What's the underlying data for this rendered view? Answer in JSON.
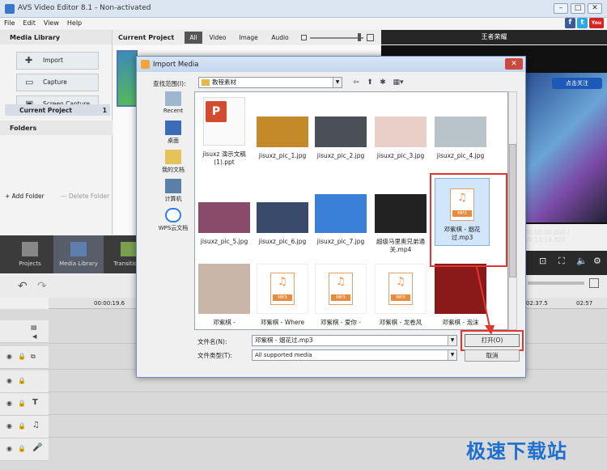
{
  "window": {
    "title": "AVS Video Editor 8.1 - Non-activated"
  },
  "menu": [
    "File",
    "Edit",
    "View",
    "Help"
  ],
  "social": [
    {
      "label": "f",
      "color": "#3b5998"
    },
    {
      "label": "t",
      "color": "#29a9e1"
    },
    {
      "label": "You",
      "color": "#d42424"
    }
  ],
  "left_panel": {
    "title": "Media Library",
    "buttons": [
      "Import",
      "Capture",
      "Screen Capture"
    ],
    "folders_title": "Folders",
    "folder": {
      "name": "Current Project",
      "count": "1"
    },
    "add_folder": "+ Add Folder",
    "delete_folder": "— Delete Folder"
  },
  "project": {
    "title": "Current Project",
    "tabs": [
      "All",
      "Video",
      "Image",
      "Audio"
    ]
  },
  "preview": {
    "title": "王者荣耀",
    "badge": "点击关注",
    "time": "00:00:00.000 / 00:13:19.400"
  },
  "toolstrip": [
    "Projects",
    "Media Library",
    "Transitions"
  ],
  "timeline": {
    "t1": "00:00:19.6",
    "t2": "02:37.5",
    "t3": "02:57"
  },
  "dialog": {
    "title": "Import Media",
    "look_in_label": "查找范围(I):",
    "look_in_value": "教程素材",
    "places": [
      "Recent",
      "桌面",
      "我的文档",
      "计算机",
      "WPS云文档"
    ],
    "files": [
      {
        "name": "jisuxz 演示文稿(1).ppt",
        "kind": "ppt"
      },
      {
        "name": "jisuxz_pic_1.jpg",
        "kind": "img",
        "color": "#c48a2a"
      },
      {
        "name": "jisuxz_pic_2.jpg",
        "kind": "img",
        "color": "#4b4f58"
      },
      {
        "name": "jisuxz_pic_3.jpg",
        "kind": "img",
        "color": "#e9cfc7"
      },
      {
        "name": "jisuxz_pic_4.jpg",
        "kind": "img",
        "color": "#b9c4c8"
      },
      {
        "name": "jisuxz_pic_5.jpg",
        "kind": "img",
        "color": "#8a4a6a"
      },
      {
        "name": "jisuxz_pic_6.jpg",
        "kind": "img",
        "color": "#3a4a6a"
      },
      {
        "name": "jisuxz_pic_7.jpg",
        "kind": "img",
        "color": "#3a7fd8"
      },
      {
        "name": "超级马里奥兄弟通关.mp4",
        "kind": "img",
        "color": "#222222"
      },
      {
        "name": "邓紫棋 - 烟花过.mp3",
        "kind": "mp3"
      },
      {
        "name": "邓紫棋 -",
        "kind": "img",
        "color": "#c9b6a8"
      },
      {
        "name": "邓紫棋 - Where",
        "kind": "mp3"
      },
      {
        "name": "邓紫棋 - 爱你 -",
        "kind": "mp3"
      },
      {
        "name": "邓紫棋 - 龙卷风",
        "kind": "mp3"
      },
      {
        "name": "邓紫棋 - 泡沫",
        "kind": "img",
        "color": "#8a1a1a"
      }
    ],
    "filename_label": "文件名(N):",
    "filename_value": "邓紫棋 - 烟花过.mp3",
    "filetype_label": "文件类型(T):",
    "filetype_value": "All supported media",
    "open_label": "打开(O)",
    "cancel_label": "取消"
  },
  "watermark": "极速下载站"
}
